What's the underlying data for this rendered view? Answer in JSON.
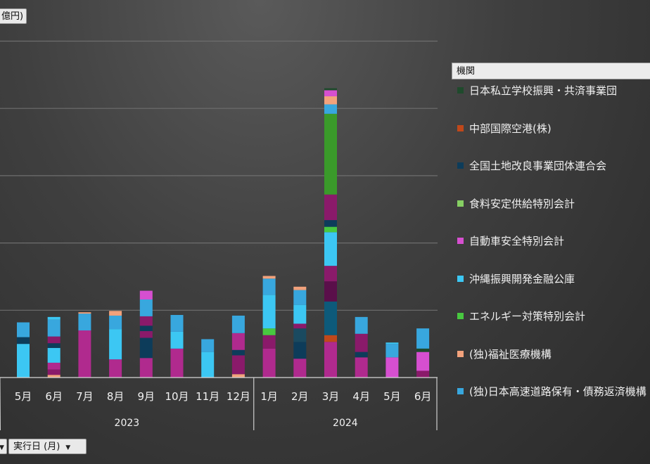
{
  "units_button": {
    "label": "億円)"
  },
  "dimension_button": {
    "label": "実行日 (月)"
  },
  "legend": {
    "title": "機関",
    "items": [
      {
        "label": "日本私立学校振興・共済事業団",
        "color": "#1f4a2c"
      },
      {
        "label": "中部国際空港(株)",
        "color": "#c0481a"
      },
      {
        "label": "全国土地改良事業団体連合会",
        "color": "#0d3c5a"
      },
      {
        "label": "食料安定供給特別会計",
        "color": "#86cf63"
      },
      {
        "label": "自動車安全特別会計",
        "color": "#d64fd0"
      },
      {
        "label": "沖縄振興開発金融公庫",
        "color": "#3cc7f3"
      },
      {
        "label": "エネルギー対策特別会計",
        "color": "#48c840"
      },
      {
        "label": "(独)福祉医療機構",
        "color": "#f2a27c"
      },
      {
        "label": "(独)日本高速道路保有・債務返済機構",
        "color": "#38a7de"
      }
    ]
  },
  "chart_data": {
    "type": "bar",
    "stacked": true,
    "ylim": [
      0,
      5
    ],
    "grid": true,
    "legend_position": "right",
    "x_groups": [
      {
        "label": "2023",
        "months": [
          "5月",
          "6月",
          "7月",
          "8月",
          "9月",
          "10月",
          "11月",
          "12月"
        ]
      },
      {
        "label": "2024",
        "months": [
          "1月",
          "2月",
          "3月",
          "4月",
          "5月",
          "6月"
        ]
      }
    ],
    "categories": [
      "5月",
      "6月",
      "7月",
      "8月",
      "9月",
      "10月",
      "11月",
      "12月",
      "1月",
      "2月",
      "3月",
      "4月",
      "5月",
      "6月"
    ],
    "stacks": [
      [
        {
          "v": 0.5,
          "c": "#3cc7f3"
        },
        {
          "v": 0.1,
          "c": "#0d3c5a"
        },
        {
          "v": 0.22,
          "c": "#38a7de"
        }
      ],
      [
        {
          "v": 0.04,
          "c": "#f2a27c"
        },
        {
          "v": 0.08,
          "c": "#8a1a6a"
        },
        {
          "v": 0.1,
          "c": "#b02a8e"
        },
        {
          "v": 0.22,
          "c": "#3cc7f3"
        },
        {
          "v": 0.07,
          "c": "#0d3c5a"
        },
        {
          "v": 0.1,
          "c": "#8a1a6a"
        },
        {
          "v": 0.25,
          "c": "#38a7de"
        },
        {
          "v": 0.04,
          "c": "#3cc7f3"
        }
      ],
      [
        {
          "v": 0.7,
          "c": "#b02a8e"
        },
        {
          "v": 0.25,
          "c": "#38a7de"
        },
        {
          "v": 0.02,
          "c": "#f2a27c"
        }
      ],
      [
        {
          "v": 0.27,
          "c": "#b02a8e"
        },
        {
          "v": 0.45,
          "c": "#3cc7f3"
        },
        {
          "v": 0.2,
          "c": "#38a7de"
        },
        {
          "v": 0.07,
          "c": "#f2a27c"
        }
      ],
      [
        {
          "v": 0.29,
          "c": "#b02a8e"
        },
        {
          "v": 0.3,
          "c": "#0d3c5a"
        },
        {
          "v": 0.1,
          "c": "#8a1a6a"
        },
        {
          "v": 0.08,
          "c": "#0d3c5a"
        },
        {
          "v": 0.14,
          "c": "#8a1a6a"
        },
        {
          "v": 0.25,
          "c": "#38a7de"
        },
        {
          "v": 0.13,
          "c": "#d64fd0"
        }
      ],
      [
        {
          "v": 0.43,
          "c": "#b02a8e"
        },
        {
          "v": 0.25,
          "c": "#3cc7f3"
        },
        {
          "v": 0.25,
          "c": "#38a7de"
        }
      ],
      [
        {
          "v": 0.38,
          "c": "#3cc7f3"
        },
        {
          "v": 0.19,
          "c": "#38a7de"
        }
      ],
      [
        {
          "v": 0.05,
          "c": "#f2a27c"
        },
        {
          "v": 0.28,
          "c": "#8a1a6a"
        },
        {
          "v": 0.08,
          "c": "#0d3c5a"
        },
        {
          "v": 0.25,
          "c": "#b02a8e"
        },
        {
          "v": 0.26,
          "c": "#38a7de"
        }
      ],
      [
        {
          "v": 0.43,
          "c": "#b02a8e"
        },
        {
          "v": 0.2,
          "c": "#8a1a6a"
        },
        {
          "v": 0.1,
          "c": "#48c840"
        },
        {
          "v": 0.5,
          "c": "#3cc7f3"
        },
        {
          "v": 0.24,
          "c": "#38a7de"
        },
        {
          "v": 0.04,
          "c": "#f2a27c"
        }
      ],
      [
        {
          "v": 0.28,
          "c": "#b02a8e"
        },
        {
          "v": 0.25,
          "c": "#0d3c5a"
        },
        {
          "v": 0.2,
          "c": "#1a4a60"
        },
        {
          "v": 0.07,
          "c": "#8a1a6a"
        },
        {
          "v": 0.28,
          "c": "#3cc7f3"
        },
        {
          "v": 0.22,
          "c": "#38a7de"
        },
        {
          "v": 0.05,
          "c": "#f2a27c"
        }
      ],
      [
        {
          "v": 0.53,
          "c": "#b02a8e"
        },
        {
          "v": 0.1,
          "c": "#c0481a"
        },
        {
          "v": 0.5,
          "c": "#0d5a7a"
        },
        {
          "v": 0.3,
          "c": "#5a0f4a"
        },
        {
          "v": 0.23,
          "c": "#8a1a6a"
        },
        {
          "v": 0.5,
          "c": "#3cc7f3"
        },
        {
          "v": 0.08,
          "c": "#48c840"
        },
        {
          "v": 0.1,
          "c": "#0d3c5a"
        },
        {
          "v": 0.38,
          "c": "#8a1a6a"
        },
        {
          "v": 1.2,
          "c": "#3a9a2a"
        },
        {
          "v": 0.14,
          "c": "#38a7de"
        },
        {
          "v": 0.12,
          "c": "#f2a27c"
        },
        {
          "v": 0.09,
          "c": "#d64fd0"
        },
        {
          "v": 0.03,
          "c": "#1f4a2c"
        }
      ],
      [
        {
          "v": 0.3,
          "c": "#b02a8e"
        },
        {
          "v": 0.08,
          "c": "#0d3c5a"
        },
        {
          "v": 0.27,
          "c": "#8a1a6a"
        },
        {
          "v": 0.25,
          "c": "#38a7de"
        }
      ],
      [
        {
          "v": 0.3,
          "c": "#d64fd0"
        },
        {
          "v": 0.2,
          "c": "#38a7de"
        },
        {
          "v": 0.02,
          "c": "#3cc7f3"
        }
      ],
      [
        {
          "v": 0.1,
          "c": "#8a1a6a"
        },
        {
          "v": 0.28,
          "c": "#d64fd0"
        },
        {
          "v": 0.05,
          "c": "#1f4a2c"
        },
        {
          "v": 0.3,
          "c": "#38a7de"
        }
      ]
    ]
  }
}
